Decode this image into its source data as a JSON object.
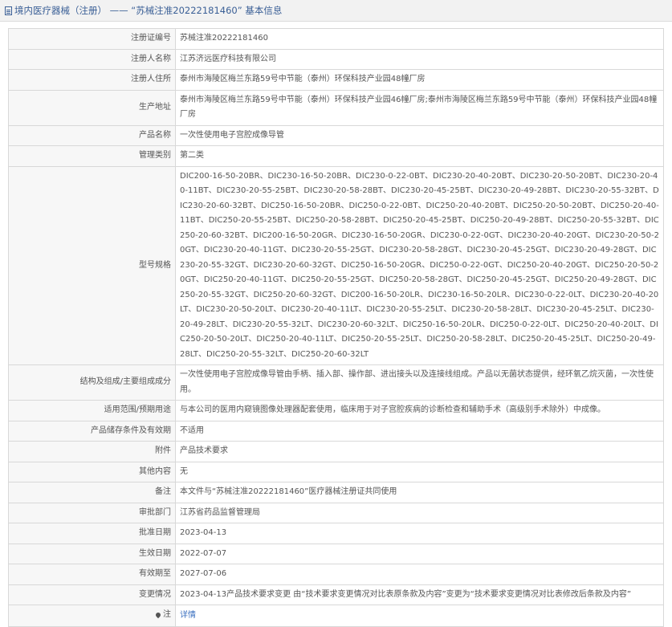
{
  "header": {
    "title": "境内医疗器械（注册） —— “苏械注准20222181460” 基本信息"
  },
  "rows": [
    {
      "label": "注册证编号",
      "value": "苏械注准20222181460"
    },
    {
      "label": "注册人名称",
      "value": "江苏济远医疗科技有限公司"
    },
    {
      "label": "注册人住所",
      "value": "泰州市海陵区梅兰东路59号中节能（泰州）环保科技产业园48幢厂房"
    },
    {
      "label": "生产地址",
      "value": "泰州市海陵区梅兰东路59号中节能（泰州）环保科技产业园46幢厂房;泰州市海陵区梅兰东路59号中节能（泰州）环保科技产业园48幢厂房"
    },
    {
      "label": "产品名称",
      "value": "一次性使用电子宫腔成像导管"
    },
    {
      "label": "管理类别",
      "value": "第二类"
    },
    {
      "label": "型号规格",
      "value": "DIC200-16-50-20BR、DIC230-16-50-20BR、DIC230-0-22-0BT、DIC230-20-40-20BT、DIC230-20-50-20BT、DIC230-20-40-11BT、DIC230-20-55-25BT、DIC230-20-58-28BT、DIC230-20-45-25BT、DIC230-20-49-28BT、DIC230-20-55-32BT、DIC230-20-60-32BT、DIC250-16-50-20BR、DIC250-0-22-0BT、DIC250-20-40-20BT、DIC250-20-50-20BT、DIC250-20-40-11BT、DIC250-20-55-25BT、DIC250-20-58-28BT、DIC250-20-45-25BT、DIC250-20-49-28BT、DIC250-20-55-32BT、DIC250-20-60-32BT、DIC200-16-50-20GR、DIC230-16-50-20GR、DIC230-0-22-0GT、DIC230-20-40-20GT、DIC230-20-50-20GT、DIC230-20-40-11GT、DIC230-20-55-25GT、DIC230-20-58-28GT、DIC230-20-45-25GT、DIC230-20-49-28GT、DIC230-20-55-32GT、DIC230-20-60-32GT、DIC250-16-50-20GR、DIC250-0-22-0GT、DIC250-20-40-20GT、DIC250-20-50-20GT、DIC250-20-40-11GT、DIC250-20-55-25GT、DIC250-20-58-28GT、DIC250-20-45-25GT、DIC250-20-49-28GT、DIC250-20-55-32GT、DIC250-20-60-32GT、DIC200-16-50-20LR、DIC230-16-50-20LR、DIC230-0-22-0LT、DIC230-20-40-20LT、DIC230-20-50-20LT、DIC230-20-40-11LT、DIC230-20-55-25LT、DIC230-20-58-28LT、DIC230-20-45-25LT、DIC230-20-49-28LT、DIC230-20-55-32LT、DIC230-20-60-32LT、DIC250-16-50-20LR、DIC250-0-22-0LT、DIC250-20-40-20LT、DIC250-20-50-20LT、DIC250-20-40-11LT、DIC250-20-55-25LT、DIC250-20-58-28LT、DIC250-20-45-25LT、DIC250-20-49-28LT、DIC250-20-55-32LT、DIC250-20-60-32LT"
    },
    {
      "label": "结构及组成/主要组成成分",
      "value": "一次性使用电子宫腔成像导管由手柄、插入部、操作部、进出接头以及连接线组成。产品以无菌状态提供，经环氧乙烷灭菌，一次性使用。"
    },
    {
      "label": "适用范围/预期用途",
      "value": "与本公司的医用内窥镜图像处理器配套使用，临床用于对子宫腔疾病的诊断检查和辅助手术（高级别手术除外）中成像。"
    },
    {
      "label": "产品储存条件及有效期",
      "value": "不适用"
    },
    {
      "label": "附件",
      "value": "产品技术要求"
    },
    {
      "label": "其他内容",
      "value": "无"
    },
    {
      "label": "备注",
      "value": "本文件与“苏械注准20222181460”医疗器械注册证共同使用"
    },
    {
      "label": "审批部门",
      "value": "江苏省药品监督管理局"
    },
    {
      "label": "批准日期",
      "value": "2023-04-13"
    },
    {
      "label": "生效日期",
      "value": "2022-07-07"
    },
    {
      "label": "有效期至",
      "value": "2027-07-06"
    },
    {
      "label": "变更情况",
      "value": "2023-04-13产品技术要求变更 由“技术要求变更情况对比表原条款及内容”变更为“技术要求变更情况对比表修改后条款及内容”"
    }
  ],
  "note_row": {
    "label": "注",
    "link": "详情"
  }
}
